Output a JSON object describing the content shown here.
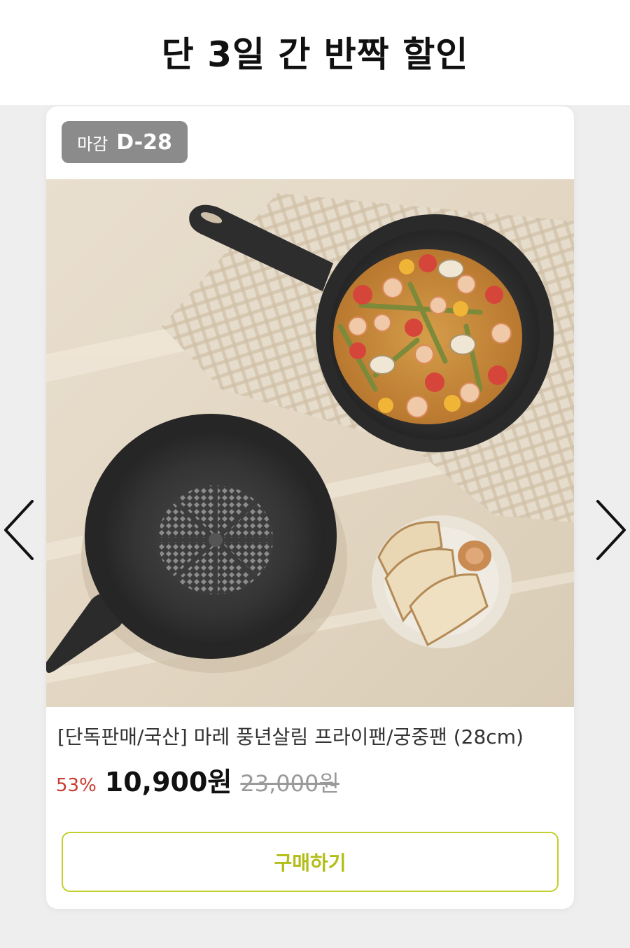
{
  "header": {
    "title": "단 3일 간 반짝 할인"
  },
  "product": {
    "deadline_label": "마감",
    "deadline_value": "D-28",
    "name": "[단독판매/국산] 마레 풍년살림 프라이팬/궁중팬 (28cm)",
    "discount_rate": "53%",
    "sale_price": "10,900원",
    "original_price": "23,000원",
    "image_alt": "product-photo: two frying pans, one with shrimp and tomatoes, plate of bread",
    "buy_label": "구매하기"
  },
  "navigation": {
    "prev_icon": "chevron-left-icon",
    "next_icon": "chevron-right-icon"
  },
  "colors": {
    "discount": "#c83a2e",
    "button_border": "#c3cf2c",
    "button_text": "#b3bd17",
    "badge_bg": "#8b8b8b"
  }
}
